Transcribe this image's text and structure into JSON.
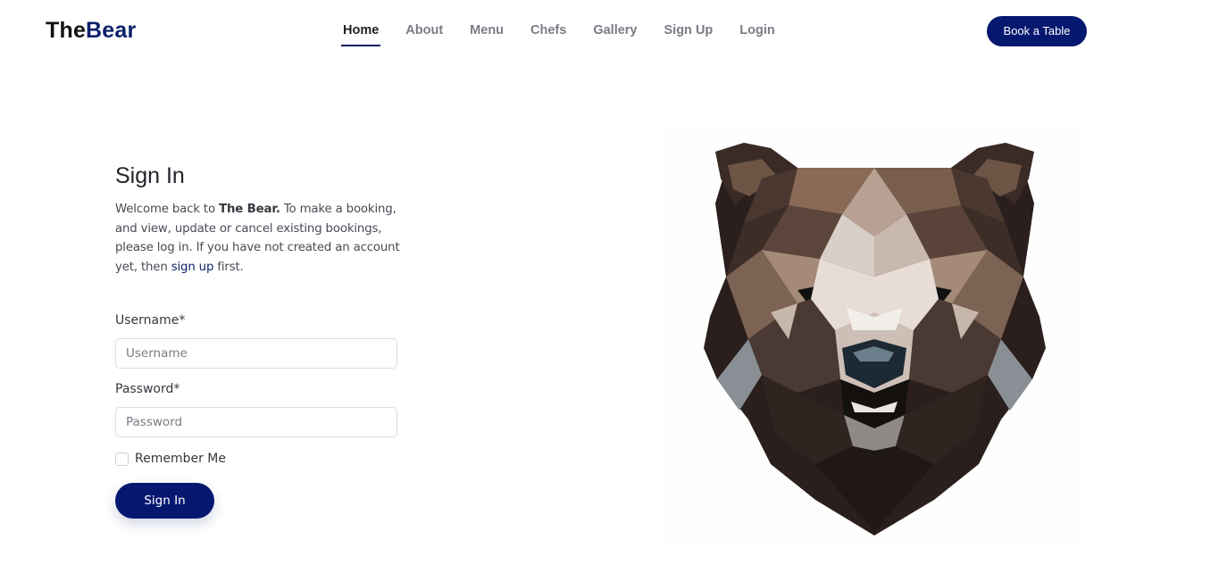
{
  "brand": {
    "prefix": "The",
    "accent": "Bear"
  },
  "nav": {
    "items": [
      {
        "label": "Home",
        "active": true
      },
      {
        "label": "About",
        "active": false
      },
      {
        "label": "Menu",
        "active": false
      },
      {
        "label": "Chefs",
        "active": false
      },
      {
        "label": "Gallery",
        "active": false
      },
      {
        "label": "Sign Up",
        "active": false
      },
      {
        "label": "Login",
        "active": false
      }
    ],
    "cta_label": "Book a Table"
  },
  "signin": {
    "title": "Sign In",
    "intro_1": "Welcome back to ",
    "intro_brand": "The Bear.",
    "intro_2": " To make a booking, and view, update or cancel existing bookings, please log in. If you have not created an account yet, then ",
    "intro_link": "sign up",
    "intro_3": " first.",
    "username_label": "Username*",
    "username_placeholder": "Username",
    "username_value": "",
    "password_label": "Password*",
    "password_placeholder": "Password",
    "password_value": "",
    "remember_label": "Remember Me",
    "remember_checked": false,
    "submit_label": "Sign In"
  },
  "hero_image": {
    "icon": "low-poly-bear-head-illustration"
  },
  "colors": {
    "brand_navy": "#051870",
    "text": "#37373f",
    "muted": "#7b7b85"
  }
}
